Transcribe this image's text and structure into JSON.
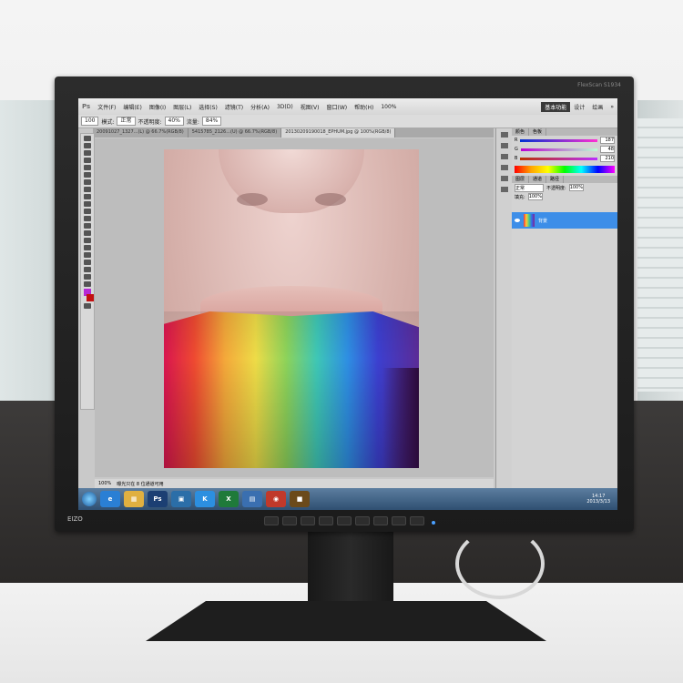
{
  "monitor": {
    "brand": "EIZO",
    "model": "FlexScan S1934"
  },
  "app": {
    "logo": "Ps",
    "menu": [
      "文件(F)",
      "编辑(E)",
      "图像(I)",
      "图层(L)",
      "选择(S)",
      "滤镜(T)",
      "分析(A)",
      "3D(D)",
      "视图(V)",
      "窗口(W)",
      "帮助(H)"
    ],
    "zoom": "100%",
    "workspace": "基本功能",
    "workspace_links": [
      "设计",
      "绘画",
      "»"
    ]
  },
  "options_bar": {
    "mode_label": "模式:",
    "mode_value": "正常",
    "opacity_label": "不透明度:",
    "opacity_value": "40%",
    "flow_label": "流量:",
    "flow_value": "84%",
    "brush_size": "100"
  },
  "tabs": [
    {
      "label": "20091027_1327...(L) @ 66.7%(RGB/8)",
      "active": false
    },
    {
      "label": "5415785_2126...(U) @ 66.7%(RGB/8)",
      "active": false
    },
    {
      "label": "20130209190018_EPHUM.jpg @ 100%(RGB/8)",
      "active": true
    }
  ],
  "status_bar": {
    "zoom": "100%",
    "doc": "曝光只在 8 位通道可用"
  },
  "panels": {
    "color_tabs": [
      "颜色",
      "色板"
    ],
    "color": {
      "r": "187",
      "g": "48",
      "b": "210"
    },
    "layers_tabs": [
      "图层",
      "通道",
      "路径"
    ],
    "blend_mode": "正常",
    "opacity_label": "不透明度:",
    "opacity_value": "100%",
    "fill_label": "填充:",
    "fill_value": "100%",
    "layer_name": "背景"
  },
  "taskbar": {
    "icons": [
      {
        "name": "ie-icon",
        "label": "e",
        "color": "#2a7fd4"
      },
      {
        "name": "explorer-icon",
        "label": "▦",
        "color": "#e0b040"
      },
      {
        "name": "photoshop-icon",
        "label": "Ps",
        "color": "#1c3f73"
      },
      {
        "name": "windows-explorer-icon",
        "label": "▣",
        "color": "#2b6ea8"
      },
      {
        "name": "kugou-icon",
        "label": "K",
        "color": "#2c8fe0"
      },
      {
        "name": "excel-icon",
        "label": "X",
        "color": "#1f7a3a"
      },
      {
        "name": "folder-icon",
        "label": "▤",
        "color": "#3a6fb0"
      },
      {
        "name": "app-red-icon",
        "label": "◉",
        "color": "#c0392b"
      },
      {
        "name": "app-gold-icon",
        "label": "■",
        "color": "#6b4a1a"
      }
    ],
    "time": "14:17",
    "date": "2013/3/13"
  }
}
